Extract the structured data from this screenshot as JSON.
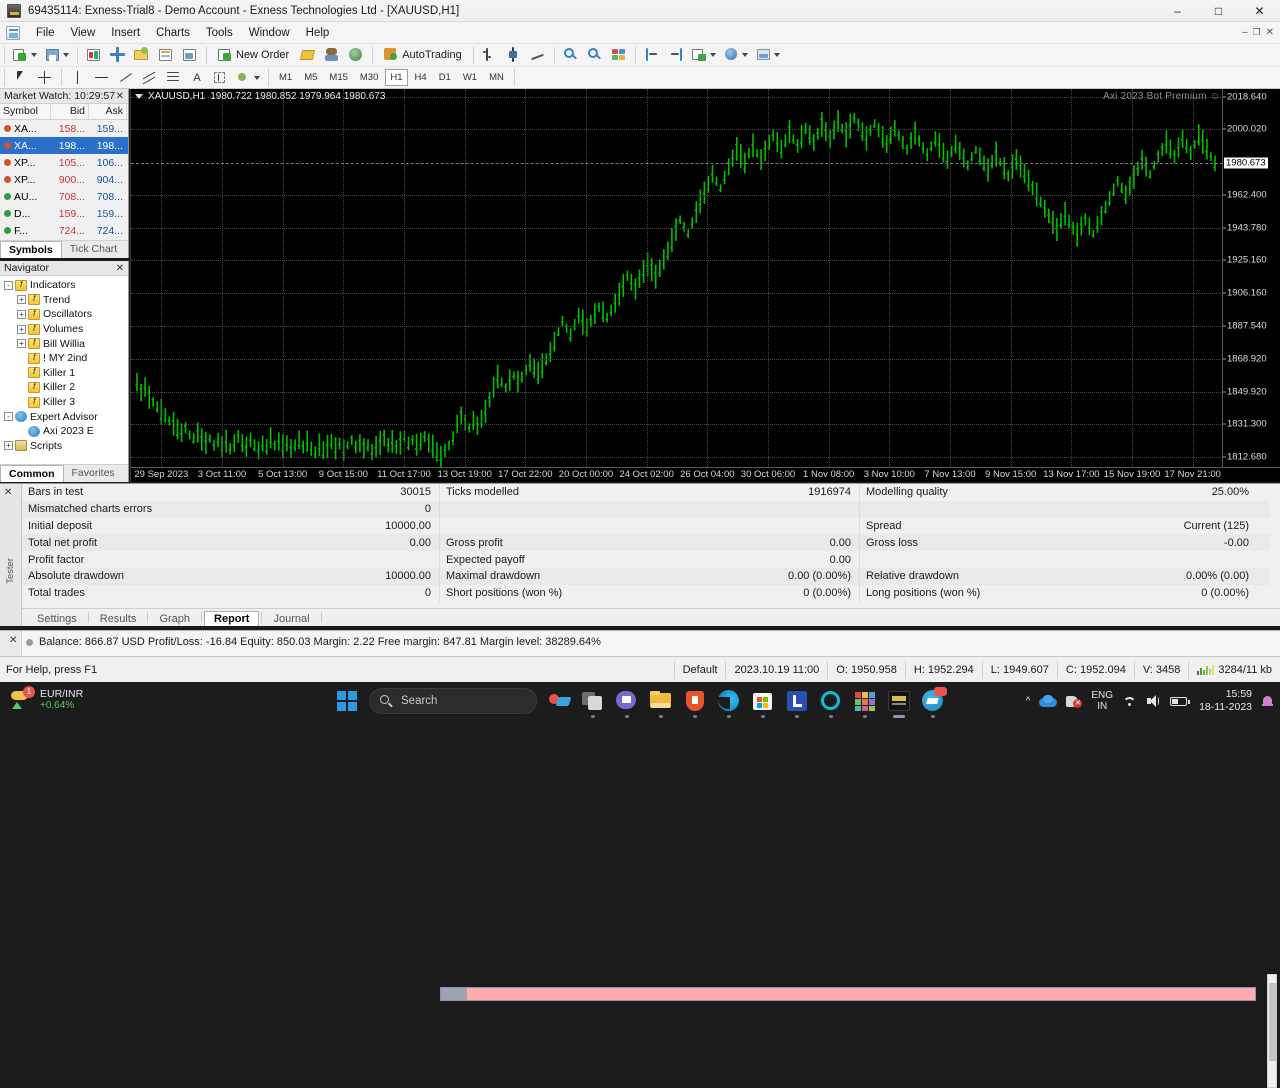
{
  "window": {
    "title": "69435114: Exness-Trial8 - Demo Account - Exness Technologies Ltd - [XAUUSD,H1]",
    "minimize": "–",
    "maximize": "□",
    "close": "✕",
    "inner_minimize": "–",
    "inner_restore": "❐",
    "inner_close": "✕"
  },
  "menu": {
    "items": [
      "File",
      "View",
      "Insert",
      "Charts",
      "Tools",
      "Window",
      "Help"
    ]
  },
  "toolbar": {
    "new_order": "New Order",
    "autotrading": "AutoTrading",
    "alert_count": "1",
    "timeframes": [
      "M1",
      "M5",
      "M15",
      "M30",
      "H1",
      "H4",
      "D1",
      "W1",
      "MN"
    ],
    "active_timeframe": "H1",
    "text_tool": "A"
  },
  "market_watch": {
    "title": "Market Watch: 10:29:57",
    "close": "✕",
    "columns": [
      "Symbol",
      "Bid",
      "Ask"
    ],
    "rows": [
      {
        "symbol": "XA...",
        "bid": "158...",
        "ask": "159...",
        "dir": "down",
        "selected": false
      },
      {
        "symbol": "XA...",
        "bid": "198...",
        "ask": "198...",
        "dir": "down",
        "selected": true
      },
      {
        "symbol": "XP...",
        "bid": "105...",
        "ask": "106...",
        "dir": "down",
        "selected": false
      },
      {
        "symbol": "XP...",
        "bid": "900...",
        "ask": "904...",
        "dir": "down",
        "selected": false
      },
      {
        "symbol": "AU...",
        "bid": "708...",
        "ask": "708...",
        "dir": "up",
        "selected": false
      },
      {
        "symbol": "D...",
        "bid": "159...",
        "ask": "159...",
        "dir": "up",
        "selected": false
      },
      {
        "symbol": "F...",
        "bid": "724...",
        "ask": "724...",
        "dir": "up",
        "selected": false
      }
    ],
    "tabs": [
      "Symbols",
      "Tick Chart"
    ],
    "active_tab": "Symbols"
  },
  "navigator": {
    "title": "Navigator",
    "close": "✕",
    "nodes": [
      {
        "label": "Indicators",
        "indent": 0,
        "expander": "-",
        "icon": "f"
      },
      {
        "label": "Trend",
        "indent": 1,
        "expander": "+",
        "icon": "f"
      },
      {
        "label": "Oscillators",
        "indent": 1,
        "expander": "+",
        "icon": "f"
      },
      {
        "label": "Volumes",
        "indent": 1,
        "expander": "+",
        "icon": "f"
      },
      {
        "label": "Bill Willia",
        "indent": 1,
        "expander": "+",
        "icon": "f"
      },
      {
        "label": "! MY 2ind",
        "indent": 1,
        "expander": "",
        "icon": "f"
      },
      {
        "label": "Killer 1",
        "indent": 1,
        "expander": "",
        "icon": "f"
      },
      {
        "label": "Killer 2",
        "indent": 1,
        "expander": "",
        "icon": "f"
      },
      {
        "label": "Killer 3",
        "indent": 1,
        "expander": "",
        "icon": "f"
      },
      {
        "label": "Expert Advisor",
        "indent": 0,
        "expander": "-",
        "icon": "ea"
      },
      {
        "label": "Axi 2023 E",
        "indent": 1,
        "expander": "",
        "icon": "ea"
      },
      {
        "label": "Scripts",
        "indent": 0,
        "expander": "+",
        "icon": "sc"
      }
    ],
    "tabs": [
      "Common",
      "Favorites"
    ],
    "active_tab": "Common"
  },
  "chart": {
    "symbol_header": "XAUUSD,H1",
    "ohlc_header": "1980.722 1980.852 1979.964 1980.673",
    "watermark": "Axi 2023 Bot Premium ☺",
    "current_price": "1980.673",
    "line_color": "#00c000",
    "background": "#000000",
    "grid_color": "#4a4a4a"
  },
  "chart_data": {
    "type": "line",
    "title": "XAUUSD,H1",
    "xlabel": "",
    "ylabel": "",
    "ylim": [
      1807.0,
      2023.0
    ],
    "grid": true,
    "y_ticks": [
      "2018.640",
      "2000.020",
      "1980.673",
      "1962.400",
      "1943.780",
      "1925.160",
      "1906.160",
      "1887.540",
      "1868.920",
      "1849.920",
      "1831.300",
      "1812.680"
    ],
    "x_ticks": [
      "29 Sep 2023",
      "3 Oct 11:00",
      "5 Oct 13:00",
      "9 Oct 15:00",
      "11 Oct 17:00",
      "13 Oct 19:00",
      "17 Oct 22:00",
      "20 Oct 00:00",
      "24 Oct 02:00",
      "26 Oct 04:00",
      "30 Oct 06:00",
      "1 Nov 08:00",
      "3 Nov 10:00",
      "7 Nov 13:00",
      "9 Nov 15:00",
      "13 Nov 17:00",
      "15 Nov 19:00",
      "17 Nov 21:00"
    ],
    "series": [
      {
        "name": "XAUUSD",
        "color": "#00c000",
        "values": [
          1855,
          1849,
          1852,
          1846,
          1844,
          1841,
          1838,
          1836,
          1833,
          1831,
          1828,
          1826,
          1829,
          1825,
          1823,
          1826,
          1822,
          1820,
          1823,
          1819,
          1822,
          1818,
          1821,
          1817,
          1820,
          1824,
          1820,
          1818,
          1822,
          1819,
          1816,
          1820,
          1818,
          1823,
          1819,
          1821,
          1818,
          1820,
          1817,
          1819,
          1822,
          1818,
          1821,
          1817,
          1815,
          1819,
          1816,
          1818,
          1821,
          1817,
          1820,
          1816,
          1819,
          1822,
          1818,
          1820,
          1817,
          1819,
          1815,
          1818,
          1820,
          1823,
          1819,
          1821,
          1818,
          1820,
          1824,
          1820,
          1822,
          1819,
          1821,
          1824,
          1820,
          1818,
          1815,
          1812,
          1816,
          1819,
          1823,
          1831,
          1836,
          1832,
          1829,
          1833,
          1830,
          1834,
          1838,
          1845,
          1852,
          1858,
          1855,
          1852,
          1856,
          1859,
          1855,
          1858,
          1862,
          1866,
          1863,
          1860,
          1864,
          1868,
          1872,
          1878,
          1884,
          1890,
          1886,
          1882,
          1888,
          1893,
          1889,
          1886,
          1890,
          1894,
          1898,
          1895,
          1892,
          1896,
          1900,
          1905,
          1910,
          1916,
          1912,
          1908,
          1914,
          1918,
          1922,
          1919,
          1915,
          1920,
          1925,
          1930,
          1936,
          1942,
          1948,
          1944,
          1940,
          1946,
          1952,
          1958,
          1963,
          1968,
          1974,
          1970,
          1966,
          1972,
          1978,
          1983,
          1988,
          1984,
          1980,
          1986,
          1990,
          1986,
          1982,
          1987,
          1992,
          1996,
          1992,
          1988,
          1993,
          1998,
          1994,
          1990,
          1995,
          2000,
          1996,
          1992,
          1997,
          2002,
          1998,
          1994,
          1999,
          2004,
          2000,
          1996,
          2001,
          2006,
          2002,
          1998,
          1994,
          1999,
          2003,
          1999,
          1995,
          1991,
          1996,
          2000,
          1996,
          1992,
          1988,
          1993,
          1997,
          1993,
          1989,
          1985,
          1990,
          1994,
          1990,
          1986,
          1982,
          1987,
          1991,
          1987,
          1983,
          1979,
          1984,
          1988,
          1984,
          1980,
          1976,
          1981,
          1985,
          1981,
          1977,
          1973,
          1978,
          1982,
          1978,
          1974,
          1970,
          1966,
          1962,
          1958,
          1954,
          1950,
          1946,
          1942,
          1947,
          1951,
          1947,
          1943,
          1939,
          1944,
          1948,
          1944,
          1940,
          1945,
          1950,
          1955,
          1960,
          1965,
          1970,
          1966,
          1962,
          1967,
          1972,
          1977,
          1982,
          1978,
          1974,
          1979,
          1984,
          1988,
          1992,
          1988,
          1984,
          1989,
          1994,
          1990,
          1986,
          1991,
          1996,
          1992,
          1988,
          1984,
          1980
        ]
      }
    ]
  },
  "report": {
    "rows": [
      {
        "k1": "Bars in test",
        "v1": "30015",
        "k2": "Ticks modelled",
        "v2": "1916974",
        "k3": "Modelling quality",
        "v3": "25.00%"
      },
      {
        "k1": "Mismatched charts errors",
        "v1": "0",
        "k2": "",
        "v2": "",
        "k3": "",
        "v3": ""
      },
      {
        "k1": "Initial deposit",
        "v1": "10000.00",
        "k2": "",
        "v2": "",
        "k3": "Spread",
        "v3": "Current (125)"
      },
      {
        "k1": "Total net profit",
        "v1": "0.00",
        "k2": "Gross profit",
        "v2": "0.00",
        "k3": "Gross loss",
        "v3": "-0.00"
      },
      {
        "k1": "Profit factor",
        "v1": "",
        "k2": "Expected payoff",
        "v2": "0.00",
        "k3": "",
        "v3": ""
      },
      {
        "k1": "Absolute drawdown",
        "v1": "10000.00",
        "k2": "Maximal drawdown",
        "v2": "0.00 (0.00%)",
        "k3": "Relative drawdown",
        "v3": "0.00% (0.00)"
      },
      {
        "k1": "Total trades",
        "v1": "0",
        "k2": "Short positions (won %)",
        "v2": "0 (0.00%)",
        "k3": "Long positions (won %)",
        "v3": "0 (0.00%)"
      }
    ],
    "quality_percent": 25,
    "quality_bar_color": "#ffabab"
  },
  "tester": {
    "side_label": "Tester",
    "close": "✕",
    "tabs": [
      "Settings",
      "Results",
      "Graph",
      "Report",
      "Journal"
    ],
    "active_tab": "Report"
  },
  "terminal": {
    "close": "✕",
    "balance": "Balance: 866.87 USD  Profit/Loss: -16.84  Equity: 850.03  Margin: 2.22  Free margin: 847.81  Margin level: 38289.64%"
  },
  "statusbar": {
    "help": "For Help, press F1",
    "profile": "Default",
    "datetime": "2023.10.19 11:00",
    "open": "O: 1950.958",
    "high": "H: 1952.294",
    "low": "L: 1949.607",
    "close": "C: 1952.094",
    "volume": "V: 3458",
    "traffic": "3284/11 kb"
  },
  "taskbar": {
    "widget_pair": "EUR/INR",
    "widget_change": "+0.64%",
    "widget_badge": "1",
    "search_placeholder": "Search",
    "tray_lang_top": "ENG",
    "tray_lang_bottom": "IN",
    "clock_time": "15:59",
    "clock_date": "18-11-2023"
  }
}
